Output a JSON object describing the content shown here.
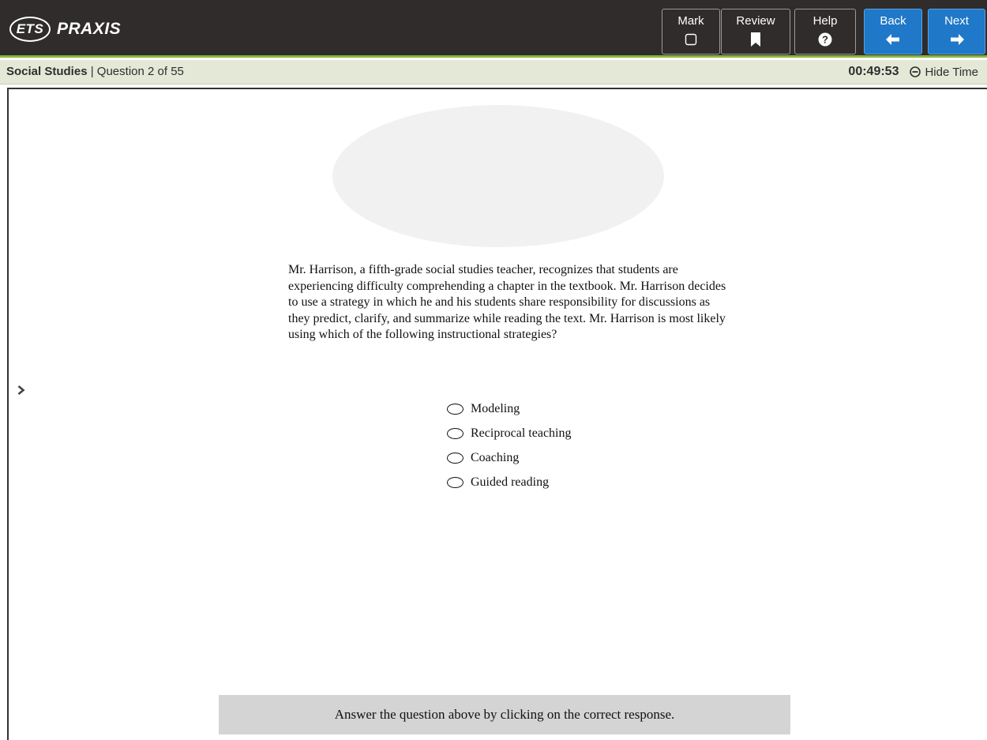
{
  "header": {
    "logo_ets": "ETS",
    "logo_praxis": "PRAXIS",
    "buttons": {
      "mark": "Mark",
      "review": "Review",
      "help": "Help",
      "back": "Back",
      "next": "Next"
    },
    "colors": {
      "toolbar_bg": "#2f2c2b",
      "accent_green": "#8db63c",
      "nav_blue": "#1f78c8"
    }
  },
  "status": {
    "subject": "Social Studies",
    "separator": "|",
    "question_progress": "Question 2 of 55",
    "timer": "00:49:53",
    "hide_time_label": "Hide Time"
  },
  "question": {
    "stem": "Mr. Harrison, a fifth-grade social studies teacher, recognizes that students are experiencing difficulty comprehending a chapter in the textbook. Mr. Harrison decides to use a strategy in which he and his students share responsibility for discussions as they predict, clarify, and summarize while reading the text. Mr. Harrison is most likely using which of the following instructional strategies?",
    "options": [
      "Modeling",
      "Reciprocal teaching",
      "Coaching",
      "Guided reading"
    ]
  },
  "footer": {
    "instruction": "Answer the question above by clicking on the correct response."
  },
  "icons": {
    "mark": "checkbox-icon",
    "review": "bookmark-icon",
    "help": "question-circle-icon",
    "back": "arrow-left-icon",
    "next": "arrow-right-icon",
    "hide_time": "minus-circle-icon",
    "expand": "chevron-right-icon"
  }
}
